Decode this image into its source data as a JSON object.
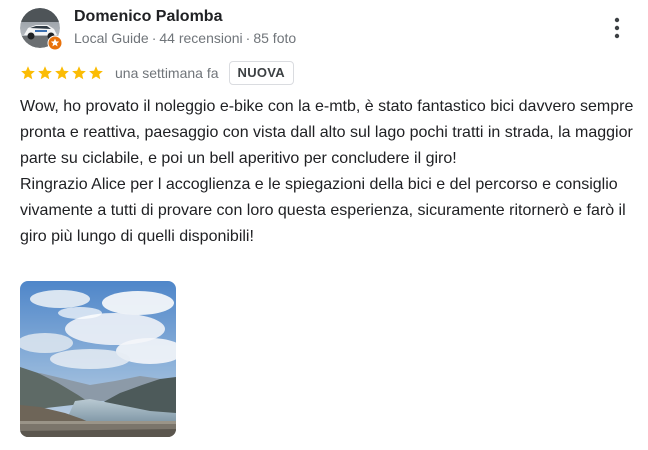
{
  "author": {
    "name": "Domenico Palomba",
    "level": "Local Guide",
    "reviews": "44 recensioni",
    "photos": "85 foto",
    "separator": "·",
    "avatar_icon": "car-photo-avatar",
    "badge_icon": "local-guide-star-badge",
    "badge_color": "#e8710a"
  },
  "review": {
    "rating": 5,
    "rating_max": 5,
    "star_color": "#fbbc04",
    "date": "una settimana fa",
    "badge": "NUOVA",
    "paragraphs": [
      "Wow, ho provato il noleggio e-bike con la e-mtb, è stato fantastico bici davvero sempre pronta e reattiva, paesaggio con vista dall alto sul lago pochi tratti in strada, la maggior parte su ciclabile, e poi un bell aperitivo per concludere il giro!",
      "Ringrazio Alice per l accoglienza e le spiegazioni della bici e del percorso e consiglio vivamente a tutti di provare con loro questa esperienza, sicuramente ritornerò e farò il giro più lungo di quelli disponibili!"
    ],
    "photo_icon": "lake-mountain-landscape-photo"
  },
  "actions": {
    "more_icon": "more-vertical-icon"
  }
}
